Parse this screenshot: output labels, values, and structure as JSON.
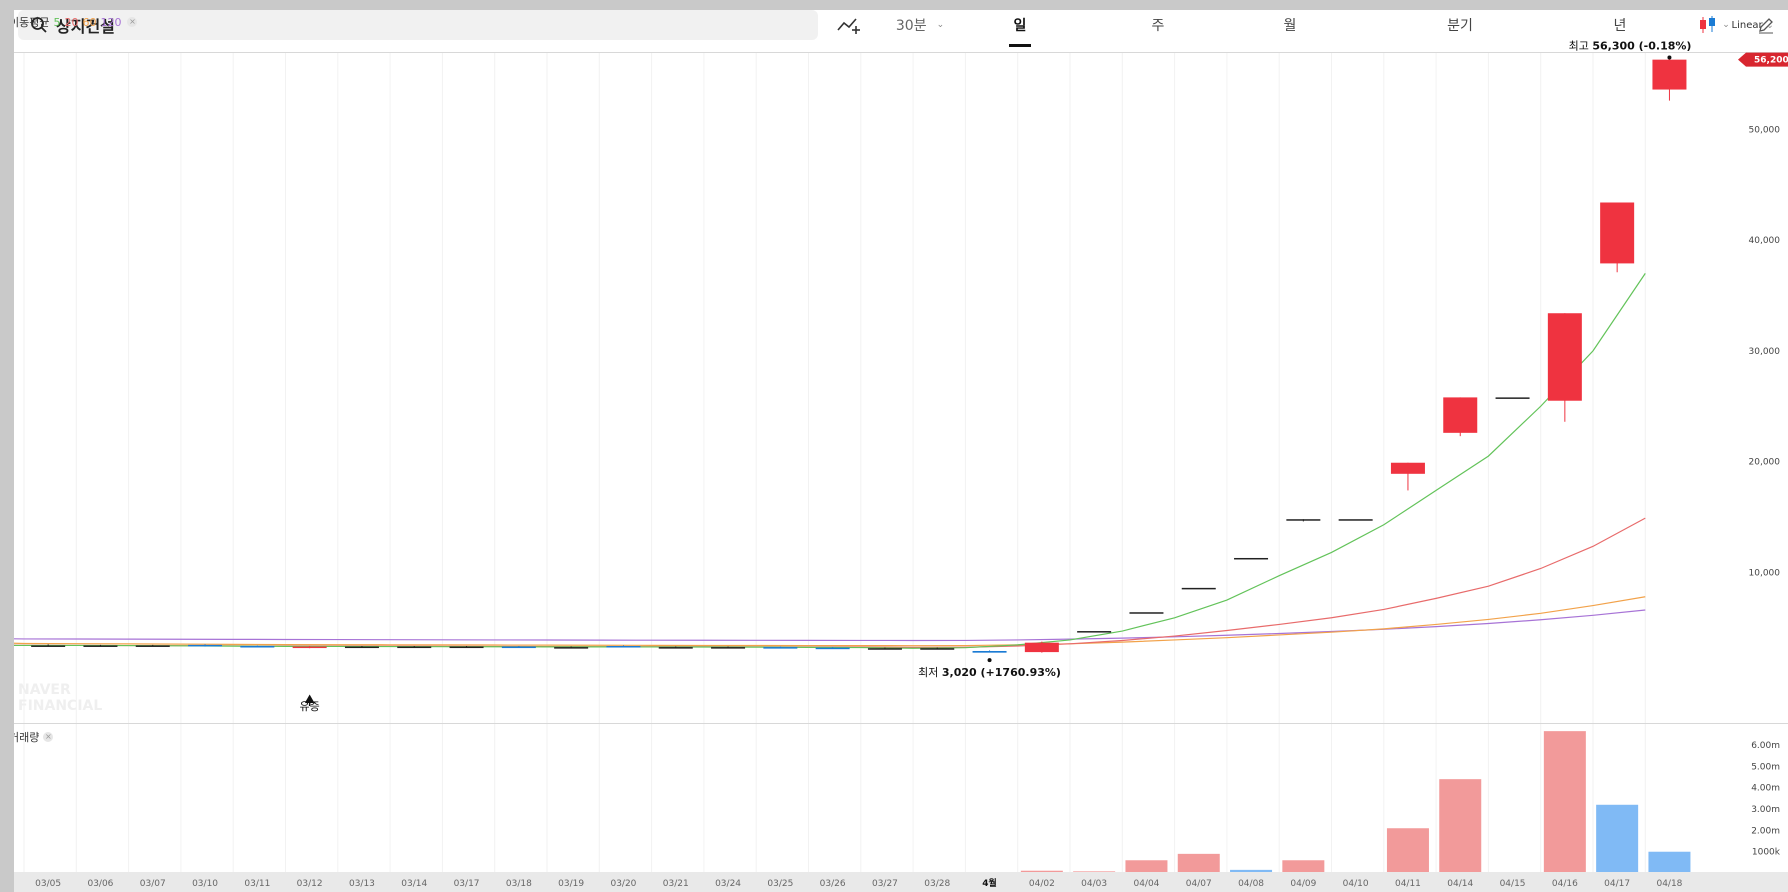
{
  "search": {
    "query": "상지건설",
    "icon": "search-icon"
  },
  "toolbar": {
    "indicator_icon": "indicator-add-icon",
    "interval": "30분",
    "tabs": [
      "일",
      "주",
      "월",
      "분기",
      "년"
    ],
    "active_tab": "일",
    "chart_type_icon": "candlestick-icon",
    "draw_icon": "pencil-icon"
  },
  "ma_legend": {
    "label": "이동평균",
    "periods": [
      "5",
      "20",
      "60",
      "120"
    ]
  },
  "scale_mode": "Linear",
  "annotations": {
    "high": {
      "label": "최고",
      "value": "56,300 (-0.18%)"
    },
    "low": {
      "label": "최저",
      "value": "3,020 (+1760.93%)"
    },
    "event": "유증",
    "current_price": "56,200"
  },
  "volume_label": "거래량",
  "watermark": [
    "NAVER",
    "FINANCIAL"
  ],
  "colors": {
    "up": "#ef3340",
    "down": "#1a7bd4",
    "ma5": "#63c35a",
    "ma20": "#e86b6b",
    "ma60": "#f2a24a",
    "ma120": "#a773d6",
    "vol_up": "#f29a9a",
    "vol_down": "#80baf5"
  },
  "chart_data": {
    "type": "candlestick",
    "y_ticks": [
      "50,000",
      "40,000",
      "30,000",
      "20,000",
      "10,000"
    ],
    "y_tick_values": [
      50000,
      40000,
      30000,
      20000,
      10000
    ],
    "ylim": [
      0,
      56800
    ],
    "volume_ticks": [
      "6.00m",
      "5.00m",
      "4.00m",
      "3.00m",
      "2.00m",
      "1000k"
    ],
    "volume_tick_values": [
      6000000,
      5000000,
      4000000,
      3000000,
      2000000,
      1000000
    ],
    "volume_ylim": [
      0,
      6700000
    ],
    "x_labels": [
      "03/05",
      "03/06",
      "03/07",
      "03/10",
      "03/11",
      "03/12",
      "03/13",
      "03/14",
      "03/17",
      "03/18",
      "03/19",
      "03/20",
      "03/21",
      "03/24",
      "03/25",
      "03/26",
      "03/27",
      "03/28",
      "4월",
      "04/02",
      "04/03",
      "04/04",
      "04/07",
      "04/08",
      "04/09",
      "04/10",
      "04/11",
      "04/14",
      "04/15",
      "04/16",
      "04/17",
      "04/18"
    ],
    "candles": [
      {
        "o": 3300,
        "h": 3400,
        "l": 3250,
        "c": 3300
      },
      {
        "o": 3300,
        "h": 3350,
        "l": 3250,
        "c": 3300
      },
      {
        "o": 3300,
        "h": 3350,
        "l": 3250,
        "c": 3300
      },
      {
        "o": 3350,
        "h": 3400,
        "l": 3200,
        "c": 3250
      },
      {
        "o": 3250,
        "h": 3300,
        "l": 3150,
        "c": 3150
      },
      {
        "o": 3100,
        "h": 3250,
        "l": 3050,
        "c": 3200
      },
      {
        "o": 3200,
        "h": 3250,
        "l": 3150,
        "c": 3200
      },
      {
        "o": 3200,
        "h": 3250,
        "l": 3150,
        "c": 3200
      },
      {
        "o": 3200,
        "h": 3250,
        "l": 3150,
        "c": 3200
      },
      {
        "o": 3200,
        "h": 3250,
        "l": 3150,
        "c": 3150
      },
      {
        "o": 3150,
        "h": 3200,
        "l": 3100,
        "c": 3150
      },
      {
        "o": 3250,
        "h": 3300,
        "l": 3150,
        "c": 3200
      },
      {
        "o": 3150,
        "h": 3200,
        "l": 3100,
        "c": 3150
      },
      {
        "o": 3150,
        "h": 3200,
        "l": 3100,
        "c": 3150
      },
      {
        "o": 3150,
        "h": 3200,
        "l": 3100,
        "c": 3100
      },
      {
        "o": 3100,
        "h": 3150,
        "l": 3000,
        "c": 3050
      },
      {
        "o": 3050,
        "h": 3100,
        "l": 3000,
        "c": 3050
      },
      {
        "o": 3050,
        "h": 3100,
        "l": 3000,
        "c": 3050
      },
      {
        "o": 2800,
        "h": 2850,
        "l": 2700,
        "c": 2650
      },
      {
        "o": 2700,
        "h": 3650,
        "l": 2650,
        "c": 3550
      },
      {
        "o": 4600,
        "h": 4600,
        "l": 4600,
        "c": 4600
      },
      {
        "o": 6300,
        "h": 6300,
        "l": 6300,
        "c": 6300
      },
      {
        "o": 8500,
        "h": 8500,
        "l": 8500,
        "c": 8500
      },
      {
        "o": 11200,
        "h": 11200,
        "l": 11200,
        "c": 11200
      },
      {
        "o": 14700,
        "h": 14700,
        "l": 14500,
        "c": 14700
      },
      {
        "o": 14700,
        "h": 14700,
        "l": 14700,
        "c": 14700
      },
      {
        "o": 18800,
        "h": 19800,
        "l": 17300,
        "c": 19800
      },
      {
        "o": 22500,
        "h": 25700,
        "l": 22200,
        "c": 25700
      },
      {
        "o": 25700,
        "h": 25700,
        "l": 25700,
        "c": 25700
      },
      {
        "o": 25400,
        "h": 33300,
        "l": 23500,
        "c": 33300
      },
      {
        "o": 37800,
        "h": 43300,
        "l": 37000,
        "c": 43300
      },
      {
        "o": 53500,
        "h": 56300,
        "l": 52500,
        "c": 56200
      }
    ],
    "ma": {
      "ma5": [
        3300,
        3300,
        3300,
        3290,
        3270,
        3240,
        3220,
        3210,
        3200,
        3190,
        3180,
        3175,
        3170,
        3165,
        3160,
        3150,
        3130,
        3110,
        3050,
        3100,
        3350,
        3800,
        4600,
        5800,
        7400,
        9600,
        11700,
        14200,
        17300,
        20400,
        24900,
        29900,
        36900
      ],
      "ma20": [
        3320,
        3310,
        3300,
        3290,
        3280,
        3260,
        3250,
        3240,
        3230,
        3220,
        3210,
        3200,
        3190,
        3185,
        3180,
        3170,
        3160,
        3150,
        3130,
        3140,
        3250,
        3450,
        3750,
        4150,
        4650,
        5200,
        5800,
        6550,
        7550,
        8650,
        10250,
        12250,
        14800
      ],
      "ma60": [
        3500,
        3480,
        3460,
        3440,
        3420,
        3400,
        3380,
        3370,
        3360,
        3350,
        3340,
        3330,
        3320,
        3310,
        3300,
        3295,
        3290,
        3285,
        3280,
        3290,
        3350,
        3450,
        3600,
        3800,
        4000,
        4250,
        4500,
        4800,
        5200,
        5650,
        6200,
        6900,
        7700
      ],
      "ma120": [
        3900,
        3890,
        3880,
        3870,
        3860,
        3850,
        3840,
        3830,
        3820,
        3810,
        3800,
        3790,
        3780,
        3775,
        3770,
        3765,
        3760,
        3755,
        3750,
        3755,
        3800,
        3870,
        3960,
        4080,
        4220,
        4380,
        4560,
        4760,
        5000,
        5280,
        5620,
        6020,
        6500
      ]
    },
    "volume": [
      0,
      0,
      0,
      0,
      0,
      0,
      0,
      0,
      0,
      0,
      0,
      0,
      0,
      0,
      0,
      0,
      0,
      0,
      0,
      60000,
      30000,
      550000,
      850000,
      100000,
      550000,
      0,
      2050000,
      4350000,
      0,
      6600000,
      3150000,
      950000
    ],
    "volume_up": [
      true,
      true,
      true,
      false,
      false,
      true,
      true,
      true,
      true,
      false,
      true,
      false,
      true,
      true,
      false,
      false,
      true,
      true,
      false,
      true,
      true,
      true,
      true,
      false,
      true,
      true,
      true,
      true,
      true,
      true,
      false,
      false
    ]
  }
}
